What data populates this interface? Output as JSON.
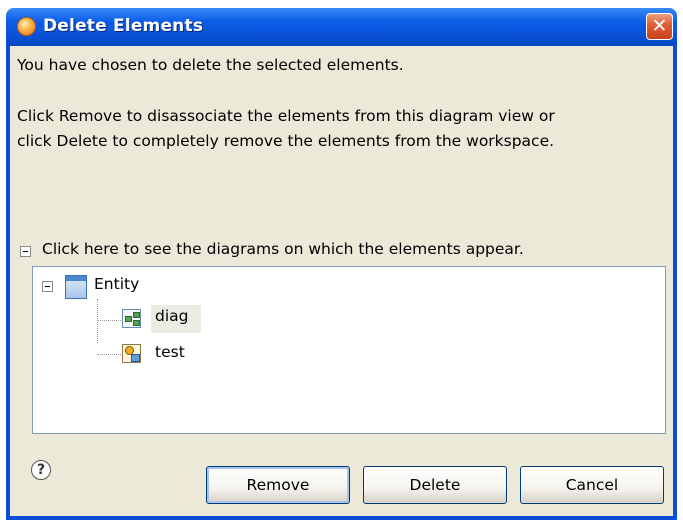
{
  "window": {
    "title": "Delete Elements",
    "close_label": "✕"
  },
  "message": {
    "line1": "You have chosen to delete the selected elements.",
    "line2": "Click Remove to disassociate the elements from this diagram view or",
    "line3": "click Delete to completely remove the elements from the workspace."
  },
  "details": {
    "toggle_label": "Click here to see the diagrams on which the elements appear."
  },
  "tree": {
    "root": {
      "label": "Entity",
      "icon": "entity-icon"
    },
    "children": [
      {
        "label": "diag",
        "icon": "diagram-icon",
        "selected": true
      },
      {
        "label": "test",
        "icon": "test-diagram-icon",
        "selected": false
      }
    ]
  },
  "buttons": {
    "remove": "Remove",
    "delete": "Delete",
    "cancel": "Cancel",
    "help": "?"
  },
  "colors": {
    "titlebar": "#0a52d8",
    "close": "#e0603a",
    "dialog_bg": "#ece9d8",
    "tree_border": "#7f9db9"
  }
}
